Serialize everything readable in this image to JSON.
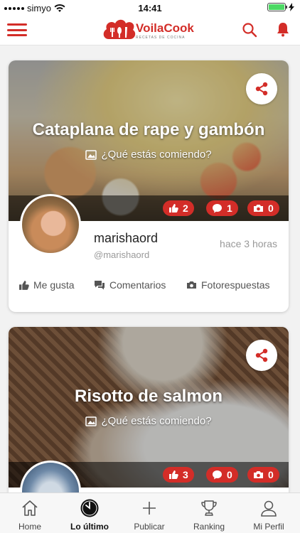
{
  "status_bar": {
    "carrier": "simyo",
    "time": "14:41"
  },
  "header": {
    "logo_name": "VoilaCook",
    "logo_tagline": "RECETAS DE COCINA"
  },
  "feed": [
    {
      "title": "Cataplana de rape y gambón",
      "prompt": "¿Qué estás comiendo?",
      "likes": "2",
      "comments": "1",
      "photos": "0",
      "username": "marishaord",
      "handle": "@marishaord",
      "time": "hace 3 horas",
      "actions": {
        "like": "Me gusta",
        "comments": "Comentarios",
        "photos": "Fotorespuestas"
      }
    },
    {
      "title": "Risotto de salmon",
      "prompt": "¿Qué estás comiendo?",
      "likes": "3",
      "comments": "0",
      "photos": "0"
    }
  ],
  "tabs": [
    {
      "label": "Home",
      "icon": "house-icon"
    },
    {
      "label": "Lo último",
      "icon": "clock-icon",
      "active": true
    },
    {
      "label": "Publicar",
      "icon": "plus-icon"
    },
    {
      "label": "Ranking",
      "icon": "trophy-icon"
    },
    {
      "label": "Mi Perfil",
      "icon": "user-icon"
    }
  ],
  "colors": {
    "brand_red": "#d32d28"
  }
}
